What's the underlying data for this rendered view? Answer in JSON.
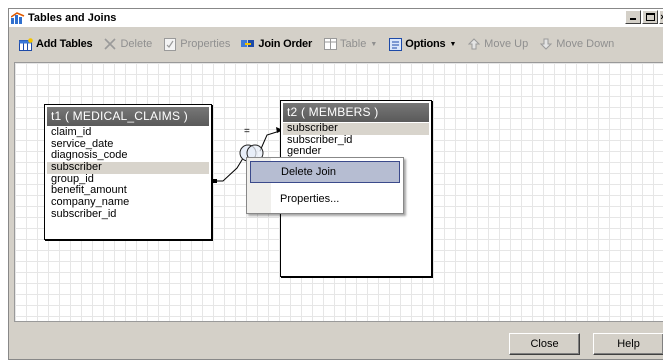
{
  "window": {
    "title": "Tables and Joins"
  },
  "toolbar": {
    "add_tables": "Add Tables",
    "delete": "Delete",
    "properties": "Properties",
    "join_order": "Join Order",
    "table": "Table",
    "options": "Options",
    "move_up": "Move Up",
    "move_down": "Move Down"
  },
  "tables": {
    "t1": {
      "title": "t1 ( MEDICAL_CLAIMS )",
      "columns": [
        "claim_id",
        "service_date",
        "diagnosis_code",
        "subscriber",
        "group_id",
        "benefit_amount",
        "company_name",
        "subscriber_id"
      ]
    },
    "t2": {
      "title": "t2 ( MEMBERS )",
      "columns": [
        "subscriber",
        "subscriber_id",
        "gender"
      ]
    }
  },
  "join": {
    "operator": "="
  },
  "context_menu": {
    "items": [
      "Delete Join",
      "Properties..."
    ]
  },
  "buttons": {
    "close": "Close",
    "help": "Help"
  },
  "colors": {
    "table_header": "#666666",
    "menu_highlight": "#b6bdd2",
    "menu_border": "#3b4a8b"
  }
}
